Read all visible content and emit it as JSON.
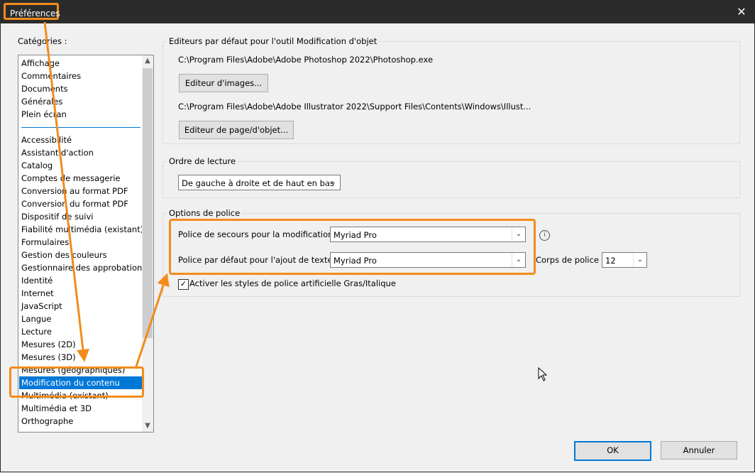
{
  "window": {
    "title": "Préférences",
    "close_glyph": "✕"
  },
  "categories": {
    "label": "Catégories :",
    "group1": [
      "Affichage",
      "Commentaires",
      "Documents",
      "Générales",
      "Plein écran"
    ],
    "group2": [
      "Accessibilité",
      "Assistant d'action",
      "Catalog",
      "Comptes de messagerie",
      "Conversion au format PDF",
      "Conversion du format PDF",
      "Dispositif de suivi",
      "Fiabilité multimédia (existant)",
      "Formulaires",
      "Gestion des couleurs",
      "Gestionnaire des approbations",
      "Identité",
      "Internet",
      "JavaScript",
      "Langue",
      "Lecture",
      "Mesures (2D)",
      "Mesures (3D)",
      "Mesures (géographiques)",
      "Modification du contenu",
      "Multimédia (existant)",
      "Multimédia et 3D",
      "Orthographe"
    ],
    "selected": "Modification du contenu"
  },
  "editors": {
    "group_label": "Editeurs par défaut pour l'outil Modification d'objet",
    "image_path": "C:\\Program Files\\Adobe\\Adobe Photoshop 2022\\Photoshop.exe",
    "image_button": "Editeur d'images...",
    "page_path": "C:\\Program Files\\Adobe\\Adobe Illustrator 2022\\Support Files\\Contents\\Windows\\Illust...",
    "page_button": "Editeur de page/d'objet..."
  },
  "reading": {
    "group_label": "Ordre de lecture",
    "value": "De gauche à droite et de haut en bas"
  },
  "fonts": {
    "group_label": "Options de police",
    "fallback_label": "Police de secours pour la modification",
    "fallback_value": "Myriad Pro",
    "default_label": "Police par défaut pour l'ajout de texte",
    "default_value": "Myriad Pro",
    "size_label": "Corps de police",
    "size_value": "12",
    "faux_styles_label": "Activer les styles de police artificielle Gras/Italique",
    "faux_styles_checked": true
  },
  "footer": {
    "ok": "OK",
    "cancel": "Annuler"
  },
  "colors": {
    "accent": "#f28c1c",
    "selection": "#0078d7"
  }
}
